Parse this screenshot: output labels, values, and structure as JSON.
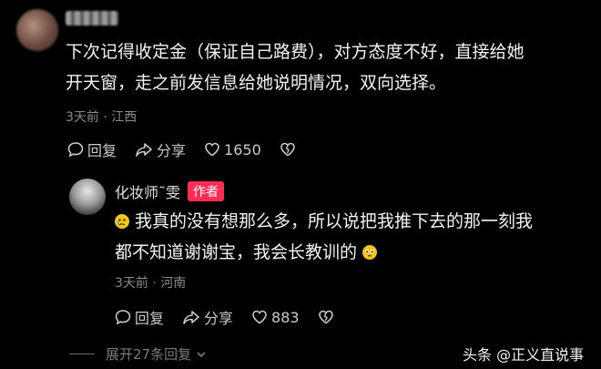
{
  "comment1": {
    "username_blurred": "",
    "text_line1": "下次记得收定金（保证自己路费），对方态度不好，直接给她",
    "text_line2": "开天窗，走之前发信息给她说明情况，双向选择。",
    "meta": "3天前 · 江西",
    "reply_label": "回复",
    "share_label": "分享",
    "like_count": "1650"
  },
  "reply": {
    "username": "化妆师˜雯",
    "author_badge": "作者",
    "text_line1": "我真的没有想那么多，所以说把我推下去的那一刻我",
    "text_line2": "都不知道谢谢宝，我会长教训的",
    "meta": "3天前 · 河南",
    "reply_label": "回复",
    "share_label": "分享",
    "like_count": "883"
  },
  "expand_label": "展开27条回复",
  "watermark": "头条 @正义直说事"
}
